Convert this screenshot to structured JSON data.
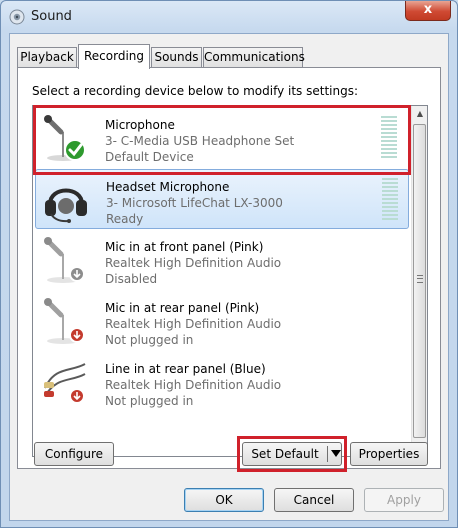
{
  "window": {
    "title": "Sound",
    "close_label": "x"
  },
  "tabs": [
    {
      "label": "Playback",
      "active": false
    },
    {
      "label": "Recording",
      "active": true
    },
    {
      "label": "Sounds",
      "active": false
    },
    {
      "label": "Communications",
      "active": false
    }
  ],
  "instruction": "Select a recording device below to modify its settings:",
  "devices": [
    {
      "name": "Microphone",
      "description": "3- C-Media USB Headphone Set",
      "status": "Default Device",
      "icon": "microphone-default-icon",
      "selected": false
    },
    {
      "name": "Headset Microphone",
      "description": "3- Microsoft LifeChat LX-3000",
      "status": "Ready",
      "icon": "headset-icon",
      "selected": true
    },
    {
      "name": "Mic in at front panel (Pink)",
      "description": "Realtek High Definition Audio",
      "status": "Disabled",
      "icon": "microphone-disabled-icon",
      "selected": false
    },
    {
      "name": "Mic in at rear panel (Pink)",
      "description": "Realtek High Definition Audio",
      "status": "Not plugged in",
      "icon": "microphone-unplugged-icon",
      "selected": false
    },
    {
      "name": "Line in at rear panel (Blue)",
      "description": "Realtek High Definition Audio",
      "status": "Not plugged in",
      "icon": "line-in-cable-icon",
      "selected": false
    }
  ],
  "buttons": {
    "configure": "Configure",
    "set_default": "Set Default",
    "properties": "Properties",
    "ok": "OK",
    "cancel": "Cancel",
    "apply": "Apply"
  },
  "colors": {
    "highlight": "#d0212b",
    "selection": "#cfe4fa",
    "check": "#2e9a2e"
  }
}
